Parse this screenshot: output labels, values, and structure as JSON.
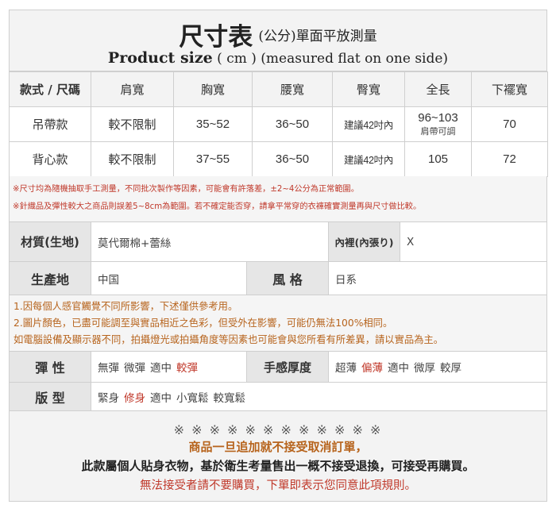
{
  "title": {
    "main": "尺寸表",
    "main_note": "(公分)單面平放測量",
    "sub_bold": "Product size",
    "sub_rest": "( cm ) (measured flat on one side)"
  },
  "size_table": {
    "headers": [
      "款式 / 尺碼",
      "肩寬",
      "胸寬",
      "腰寬",
      "臀寬",
      "全長",
      "下襬寬"
    ],
    "rows": [
      {
        "style": "吊帶款",
        "shoulder": "較不限制",
        "chest": "35~52",
        "waist": "36~50",
        "hip": "建議42吋內",
        "length": "96~103",
        "length_note": "肩帶可調",
        "hem": "70"
      },
      {
        "style": "背心款",
        "shoulder": "較不限制",
        "chest": "37~55",
        "waist": "36~50",
        "hip": "建議42吋內",
        "length": "105",
        "hem": "72"
      }
    ]
  },
  "measure_notes": [
    "※尺寸均為隨機抽取手工測量，不同批次製作等因素，可能會有許落差，±2~4公分為正常範圍。",
    "※針織品及彈性較大之商品則誤差5~8cm為範圍。若不確定能否穿，請拿平常穿的衣褲確實測量再與尺寸做比較。"
  ],
  "material": {
    "label": "材質(生地)",
    "value": "莫代爾棉+蕾絲",
    "lining_label": "內裡(內張り)",
    "lining_value": "X"
  },
  "origin": {
    "label": "生產地",
    "value": "中国",
    "style_label": "風 格",
    "style_value": "日系"
  },
  "color_notes": [
    "1.因每個人感官觸覺不同所影響，下述僅供參考用。",
    "2.圖片顏色，已盡可能調至與實品相近之色彩，但受外在影響，可能仍無法100%相同。",
    "如電腦設備及顯示器不同，拍攝燈光或拍攝角度等因素也可能會與您所看有所差異，請以實品為主。"
  ],
  "elasticity": {
    "label": "彈 性",
    "options": [
      "無彈",
      "微彈",
      "適中",
      "較彈"
    ],
    "selected": "較彈"
  },
  "thickness": {
    "label": "手感厚度",
    "options": [
      "超薄",
      "偏薄",
      "適中",
      "微厚",
      "較厚"
    ],
    "selected": "偏薄"
  },
  "fit": {
    "label": "版 型",
    "options": [
      "緊身",
      "修身",
      "適中",
      "小寬鬆",
      "較寬鬆"
    ],
    "selected": "修身"
  },
  "notice": {
    "stars": "※ ※ ※ ※ ※ ※ ※ ※ ※ ※ ※ ※",
    "line1": "商品一旦追加就不接受取消訂單，",
    "line2": "此款屬個人貼身衣物，基於衛生考量售出一概不接受退換，可接受再購買。",
    "line3": "無法接受者請不要購買，下單即表示您同意此項規則。"
  },
  "colors": {
    "highlight_red": "#c0392b",
    "note_orange": "#b7641d",
    "label_bg": "#e6e6e6",
    "border": "#cfcfcf"
  }
}
